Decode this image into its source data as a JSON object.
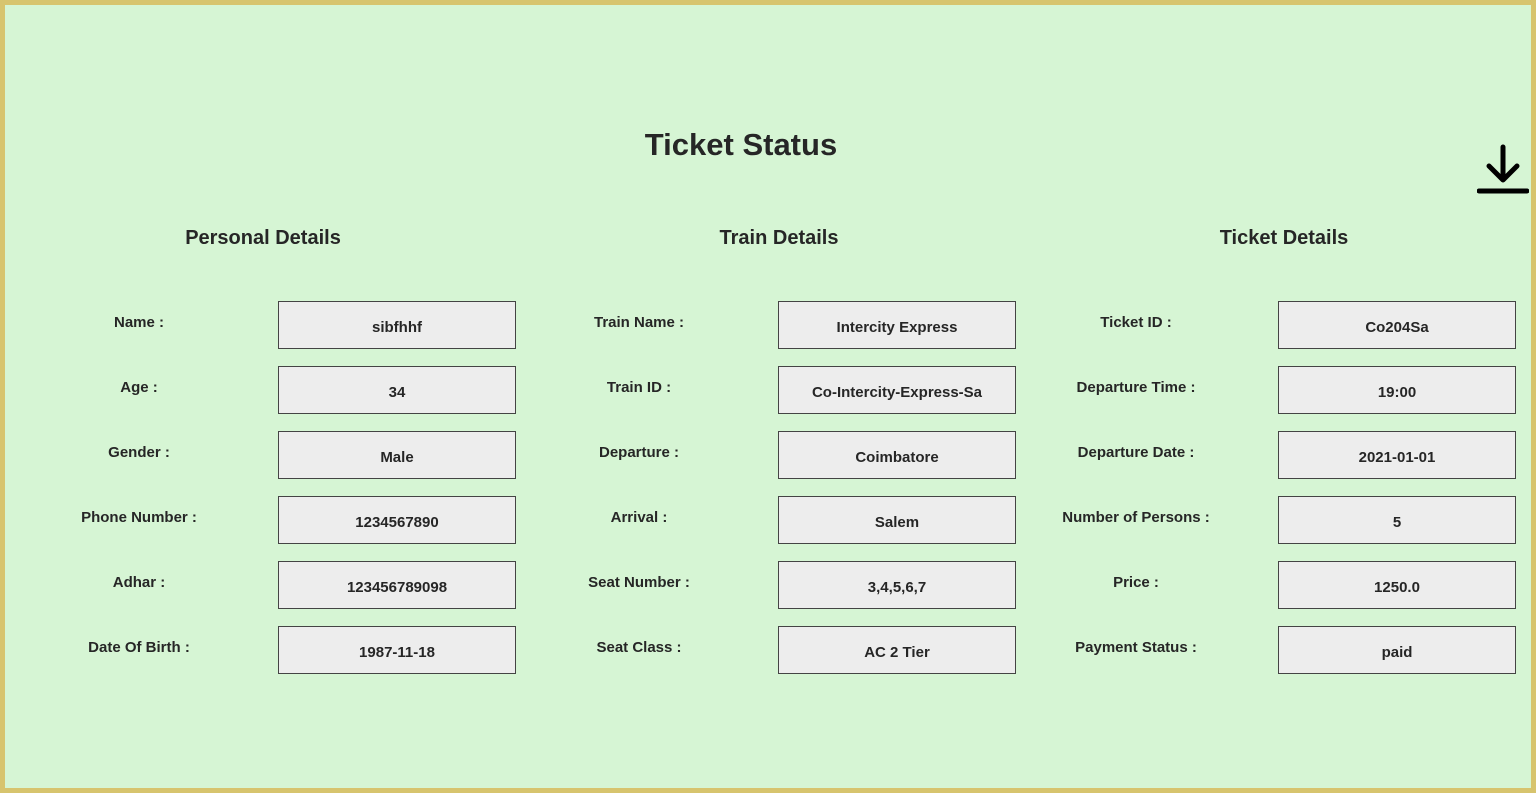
{
  "page": {
    "title": "Ticket Status"
  },
  "toolbar": {
    "download_icon": "download-icon"
  },
  "sections": {
    "personal": {
      "title": "Personal Details",
      "fields": [
        {
          "label": "Name :",
          "value": "sibfhhf"
        },
        {
          "label": "Age :",
          "value": "34"
        },
        {
          "label": "Gender :",
          "value": "Male"
        },
        {
          "label": "Phone Number :",
          "value": "1234567890"
        },
        {
          "label": "Adhar :",
          "value": "123456789098"
        },
        {
          "label": "Date Of Birth :",
          "value": "1987-11-18"
        }
      ]
    },
    "train": {
      "title": "Train Details",
      "fields": [
        {
          "label": "Train Name :",
          "value": "Intercity Express"
        },
        {
          "label": "Train ID :",
          "value": "Co-Intercity-Express-Sa"
        },
        {
          "label": "Departure  :",
          "value": "Coimbatore"
        },
        {
          "label": "Arrival :",
          "value": "Salem"
        },
        {
          "label": "Seat Number :",
          "value": "3,4,5,6,7"
        },
        {
          "label": "Seat Class :",
          "value": "AC 2 Tier"
        }
      ]
    },
    "ticket": {
      "title": "Ticket Details",
      "fields": [
        {
          "label": "Ticket ID :",
          "value": "Co204Sa"
        },
        {
          "label": "Departure Time :",
          "value": "19:00"
        },
        {
          "label": "Departure Date :",
          "value": "2021-01-01"
        },
        {
          "label": "Number of Persons :",
          "value": "5"
        },
        {
          "label": "Price :",
          "value": "1250.0"
        },
        {
          "label": "Payment Status :",
          "value": "paid"
        }
      ]
    }
  }
}
